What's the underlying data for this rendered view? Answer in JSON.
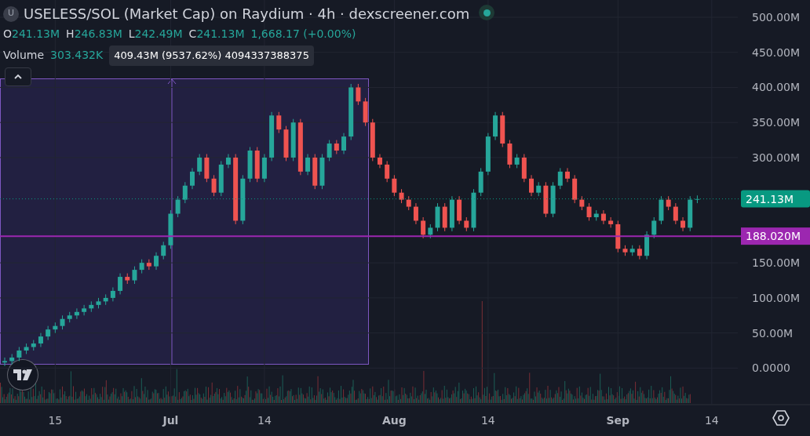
{
  "header": {
    "badge": "U",
    "title": "USELESS/SOL (Market Cap) on Raydium · 4h · dexscreener.com",
    "ohlc": [
      {
        "label": "O",
        "value": "241.13M"
      },
      {
        "label": "H",
        "value": "246.83M"
      },
      {
        "label": "L",
        "value": "242.49M"
      },
      {
        "label": "C",
        "value": "241.13M"
      }
    ],
    "change": "1,668.17 (+0.00%)",
    "volume": {
      "label": "Volume",
      "value": "303.432K"
    }
  },
  "measure_tooltip": "409.43M (9537.62%) 4094337388375",
  "chart_data": {
    "type": "candlestick",
    "grid": true,
    "ylim": [
      -51,
      500
    ],
    "yticks": [
      {
        "value": 0,
        "label": "0.0000"
      },
      {
        "value": 50,
        "label": "50.00M"
      },
      {
        "value": 100,
        "label": "100.00M"
      },
      {
        "value": 150,
        "label": "150.00M"
      },
      {
        "value": 300,
        "label": "300.00M"
      },
      {
        "value": 350,
        "label": "350.00M"
      },
      {
        "value": 400,
        "label": "400.00M"
      },
      {
        "value": 450,
        "label": "450.00M"
      },
      {
        "value": 500,
        "label": "500.00M"
      }
    ],
    "categories": [
      null,
      null,
      null,
      null,
      null,
      null,
      null,
      "15",
      null,
      null,
      null,
      null,
      null,
      null,
      null,
      null,
      null,
      null,
      null,
      null,
      null,
      null,
      null,
      "Jul",
      null,
      null,
      null,
      null,
      null,
      null,
      null,
      null,
      null,
      null,
      null,
      null,
      "14",
      null,
      null,
      null,
      null,
      null,
      null,
      null,
      null,
      null,
      null,
      null,
      null,
      null,
      null,
      null,
      null,
      null,
      "Aug",
      null,
      null,
      null,
      null,
      null,
      null,
      null,
      null,
      null,
      null,
      null,
      null,
      "14",
      null,
      null,
      null,
      null,
      null,
      null,
      null,
      null,
      null,
      null,
      null,
      null,
      null,
      null,
      null,
      null,
      null,
      "Sep",
      null,
      null,
      null,
      null,
      null,
      null,
      null,
      null,
      null,
      null,
      null,
      null,
      "14"
    ],
    "ohlc": [
      [
        8,
        15,
        3,
        10
      ],
      [
        10,
        20,
        5,
        15
      ],
      [
        15,
        30,
        10,
        25
      ],
      [
        25,
        35,
        20,
        30
      ],
      [
        30,
        40,
        25,
        35
      ],
      [
        35,
        50,
        30,
        45
      ],
      [
        45,
        60,
        40,
        55
      ],
      [
        55,
        65,
        50,
        60
      ],
      [
        60,
        75,
        55,
        70
      ],
      [
        70,
        80,
        65,
        75
      ],
      [
        75,
        85,
        70,
        80
      ],
      [
        80,
        90,
        75,
        85
      ],
      [
        85,
        95,
        80,
        90
      ],
      [
        90,
        100,
        85,
        95
      ],
      [
        95,
        105,
        90,
        100
      ],
      [
        100,
        115,
        95,
        110
      ],
      [
        110,
        135,
        105,
        130
      ],
      [
        130,
        135,
        120,
        125
      ],
      [
        125,
        145,
        120,
        140
      ],
      [
        140,
        155,
        135,
        150
      ],
      [
        150,
        155,
        140,
        145
      ],
      [
        145,
        165,
        140,
        160
      ],
      [
        160,
        180,
        155,
        175
      ],
      [
        175,
        225,
        170,
        220
      ],
      [
        220,
        245,
        215,
        240
      ],
      [
        240,
        265,
        235,
        260
      ],
      [
        260,
        285,
        255,
        280
      ],
      [
        280,
        305,
        275,
        300
      ],
      [
        300,
        305,
        265,
        270
      ],
      [
        270,
        275,
        245,
        250
      ],
      [
        250,
        295,
        245,
        290
      ],
      [
        290,
        305,
        285,
        300
      ],
      [
        300,
        305,
        205,
        210
      ],
      [
        210,
        275,
        205,
        270
      ],
      [
        270,
        315,
        265,
        310
      ],
      [
        310,
        315,
        265,
        270
      ],
      [
        270,
        305,
        265,
        300
      ],
      [
        300,
        365,
        295,
        360
      ],
      [
        360,
        365,
        335,
        340
      ],
      [
        340,
        345,
        295,
        300
      ],
      [
        300,
        355,
        295,
        350
      ],
      [
        350,
        355,
        275,
        280
      ],
      [
        280,
        305,
        275,
        300
      ],
      [
        300,
        305,
        255,
        260
      ],
      [
        260,
        305,
        255,
        300
      ],
      [
        300,
        325,
        295,
        320
      ],
      [
        320,
        325,
        305,
        310
      ],
      [
        310,
        335,
        305,
        330
      ],
      [
        330,
        405,
        325,
        400
      ],
      [
        400,
        405,
        375,
        380
      ],
      [
        380,
        385,
        345,
        350
      ],
      [
        350,
        355,
        295,
        300
      ],
      [
        300,
        305,
        285,
        290
      ],
      [
        290,
        295,
        265,
        270
      ],
      [
        270,
        275,
        245,
        250
      ],
      [
        250,
        255,
        235,
        240
      ],
      [
        240,
        245,
        225,
        230
      ],
      [
        230,
        235,
        205,
        210
      ],
      [
        210,
        215,
        185,
        190
      ],
      [
        190,
        205,
        185,
        200
      ],
      [
        200,
        235,
        195,
        230
      ],
      [
        230,
        235,
        195,
        200
      ],
      [
        200,
        245,
        195,
        240
      ],
      [
        240,
        245,
        205,
        210
      ],
      [
        210,
        215,
        195,
        200
      ],
      [
        200,
        255,
        195,
        250
      ],
      [
        250,
        285,
        245,
        280
      ],
      [
        280,
        335,
        275,
        330
      ],
      [
        330,
        365,
        325,
        360
      ],
      [
        360,
        365,
        315,
        320
      ],
      [
        320,
        325,
        285,
        290
      ],
      [
        290,
        305,
        285,
        300
      ],
      [
        300,
        305,
        265,
        270
      ],
      [
        270,
        275,
        245,
        250
      ],
      [
        250,
        265,
        245,
        260
      ],
      [
        260,
        265,
        215,
        220
      ],
      [
        220,
        265,
        215,
        260
      ],
      [
        260,
        285,
        255,
        280
      ],
      [
        280,
        285,
        265,
        270
      ],
      [
        270,
        275,
        235,
        240
      ],
      [
        240,
        245,
        225,
        230
      ],
      [
        230,
        235,
        210,
        215
      ],
      [
        215,
        225,
        210,
        220
      ],
      [
        220,
        225,
        205,
        210
      ],
      [
        210,
        215,
        200,
        205
      ],
      [
        205,
        210,
        165,
        170
      ],
      [
        170,
        175,
        160,
        165
      ],
      [
        165,
        175,
        160,
        170
      ],
      [
        170,
        175,
        155,
        160
      ],
      [
        160,
        195,
        155,
        190
      ],
      [
        190,
        215,
        185,
        210
      ],
      [
        210,
        245,
        205,
        240
      ],
      [
        240,
        245,
        225,
        230
      ],
      [
        230,
        235,
        205,
        210
      ],
      [
        210,
        215,
        195,
        200
      ],
      [
        200,
        245,
        195,
        240
      ],
      [
        240,
        246,
        235,
        241
      ],
      null,
      null
    ]
  },
  "price_lines": [
    {
      "label": "241.13M",
      "color": "#089981"
    },
    {
      "label": "188.020M",
      "color": "#9c27b0"
    }
  ]
}
